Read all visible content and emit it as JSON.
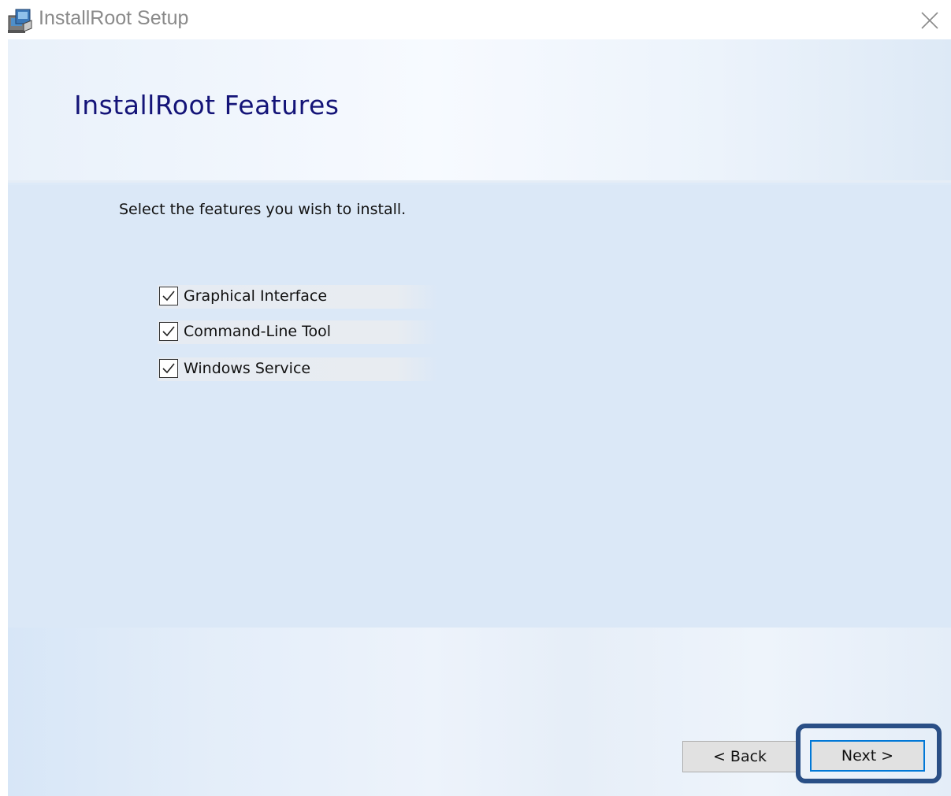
{
  "window": {
    "title": "InstallRoot Setup",
    "app_icon": "installer-icon",
    "close_icon": "close-icon"
  },
  "header": {
    "title": "InstallRoot Features"
  },
  "body": {
    "instruction": "Select the features you wish to install.",
    "features": [
      {
        "label": "Graphical Interface",
        "checked": true
      },
      {
        "label": "Command-Line Tool",
        "checked": true
      },
      {
        "label": "Windows Service",
        "checked": true
      }
    ]
  },
  "footer": {
    "back_label": "< Back",
    "next_label": "Next >"
  },
  "colors": {
    "title_blue": "#141478",
    "focus_blue": "#0078d7",
    "highlight_outline": "#2a4f86",
    "panel_bg": "#dbe8f7"
  }
}
